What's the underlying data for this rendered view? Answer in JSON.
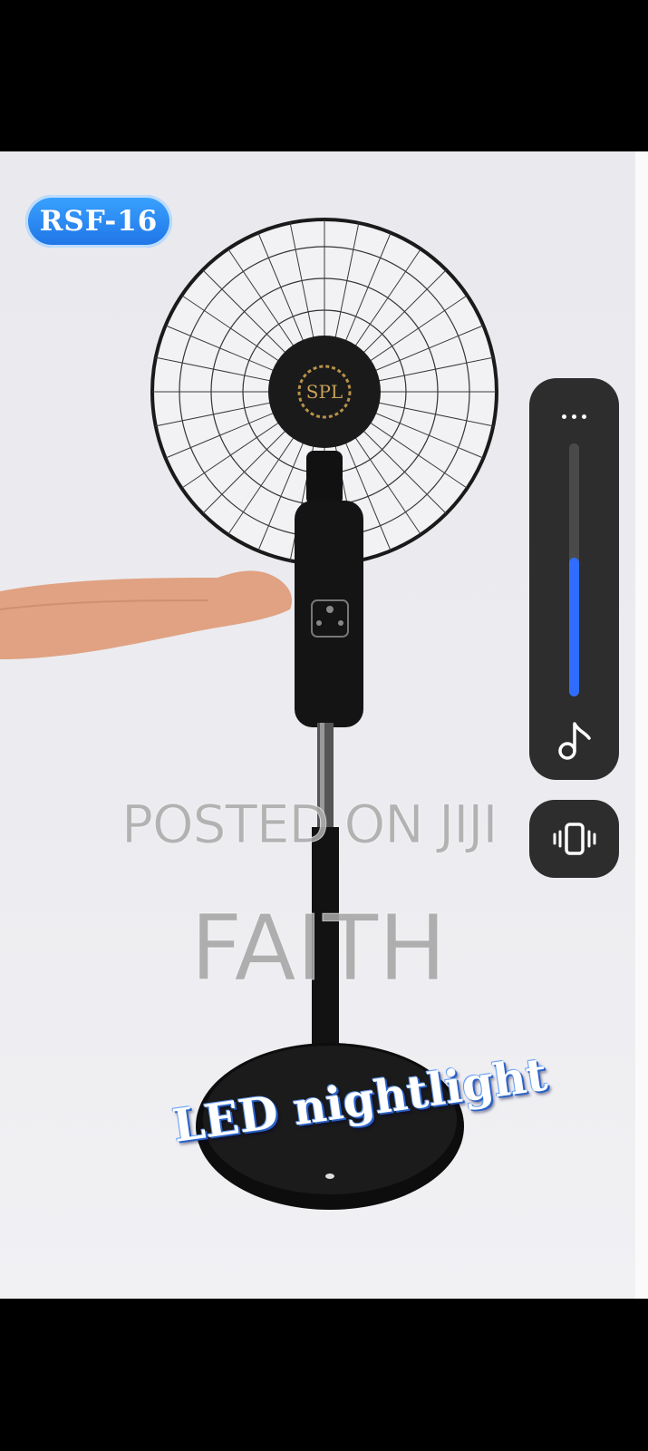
{
  "video": {
    "model_badge": "RSF-16",
    "caption": "LED nightlight",
    "logo_text": "SPL"
  },
  "watermark": {
    "line1": "POSTED ON JIJI",
    "line2": "FAITH"
  },
  "volume_panel": {
    "level": 0.55,
    "accent_color": "#2f6dff",
    "icons": [
      "more-icon",
      "music-note-icon",
      "vibrate-icon"
    ]
  }
}
